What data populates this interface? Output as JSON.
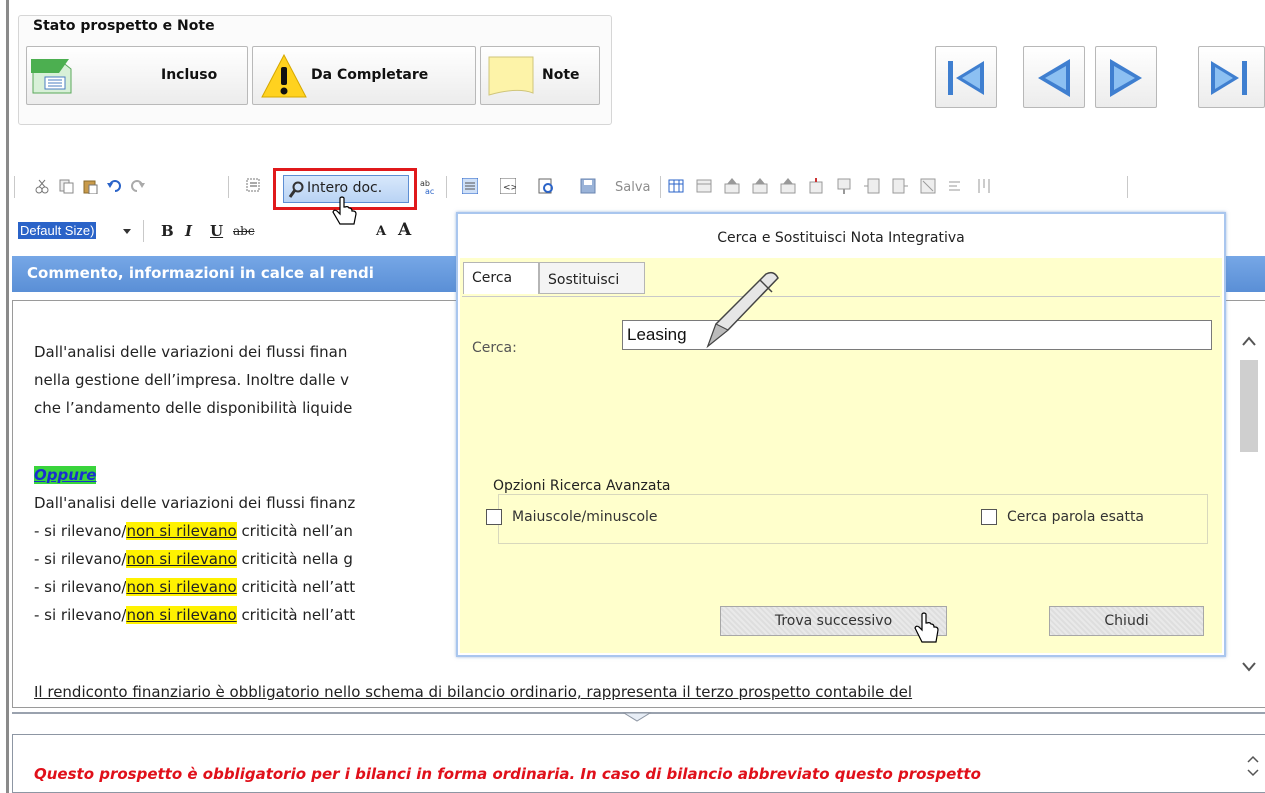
{
  "stato": {
    "title": "Stato prospetto e Note",
    "buttons": [
      {
        "label": "Incluso",
        "icon": "document-list-icon"
      },
      {
        "label": "Da Completare",
        "icon": "warning-icon"
      },
      {
        "label": "Note",
        "icon": "note-icon"
      }
    ]
  },
  "nav": {
    "first": "first-record-icon",
    "prev": "previous-record-icon",
    "next": "next-record-icon",
    "last": "last-record-icon"
  },
  "toolbar": {
    "intero_label": "Intero doc.",
    "salva_label": "Salva",
    "font_size": "Default Size)"
  },
  "section": {
    "title": "Commento, informazioni in calce al rendi"
  },
  "editor": {
    "lines": [
      "Dall'analisi delle variazioni dei flussi finan",
      "nella gestione dell’impresa. Inoltre dalle v",
      "che l’andamento delle disponibilità liquide"
    ],
    "oppure": "Oppure",
    "line_after": "Dall'analisi delle variazioni dei flussi finanz",
    "bullets": [
      {
        "prefix": "- si rilevano/",
        "hl": "non si rilevano",
        "suffix": " criticità nell’an"
      },
      {
        "prefix": "- si rilevano/",
        "hl": "non si rilevano",
        "suffix": " criticità nella g"
      },
      {
        "prefix": "- si rilevano/",
        "hl": "non si rilevano",
        "suffix": " criticità nell’att"
      },
      {
        "prefix": "- si rilevano/",
        "hl": "non si rilevano",
        "suffix": " criticità nell’att"
      }
    ],
    "last_line": "Il rendiconto finanziario è obbligatorio nello schema di bilancio ordinario, rappresenta il terzo prospetto contabile del"
  },
  "bottom": {
    "note": "Questo prospetto è obbligatorio per i bilanci in forma ordinaria. In caso di bilancio abbreviato questo prospetto"
  },
  "dialog": {
    "title": "Cerca e Sostituisci Nota Integrativa",
    "tabs": [
      "Cerca",
      "Sostituisci"
    ],
    "search_label": "Cerca:",
    "search_value": "Leasing",
    "advanced_title": "Opzioni Ricerca Avanzata",
    "opt_case": "Maiuscole/minuscole",
    "opt_exact": "Cerca parola esatta",
    "find_next": "Trova successivo",
    "close": "Chiudi"
  },
  "colors": {
    "accent_blue": "#5a8fd6",
    "highlight_yellow": "#fff200",
    "highlight_green": "#39d43c",
    "warning_red": "#e0101a",
    "dialog_bg": "#ffffcc"
  }
}
